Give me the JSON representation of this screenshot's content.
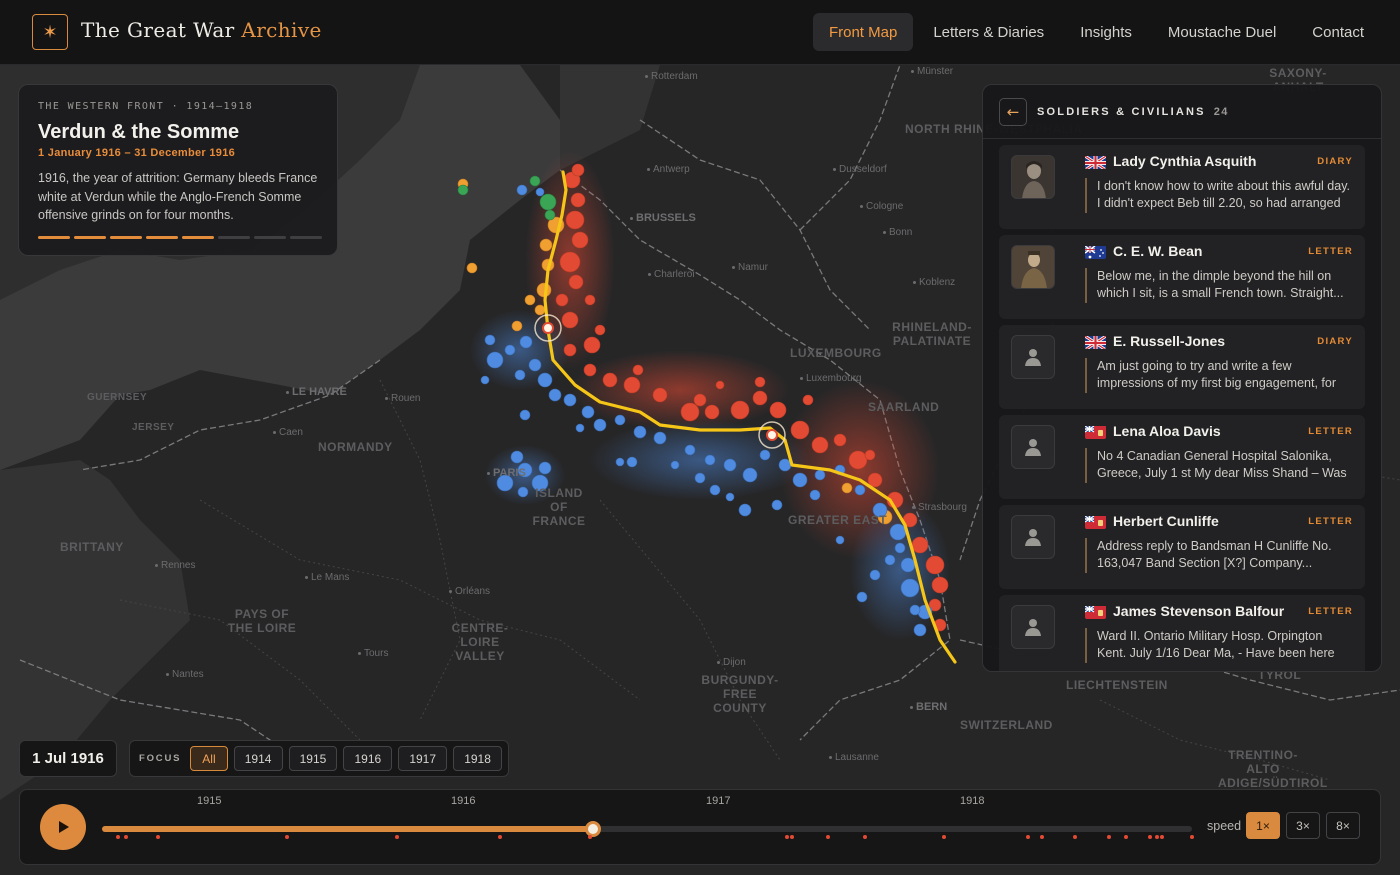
{
  "header": {
    "brand_main": "The Great War ",
    "brand_accent": "Archive",
    "nav": [
      "Front Map",
      "Letters & Diaries",
      "Insights",
      "Moustache Duel",
      "Contact"
    ],
    "active_nav": "Front Map"
  },
  "map": {
    "regions": [
      "NORTH RHINE-WESTPHALIA",
      "RHINELAND-PALATINATE",
      "LUXEMBOURG",
      "SAARLAND",
      "NORMANDY",
      "BRITTANY",
      "PAYS OF THE LOIRE",
      "CENTRE-LOIRE VALLEY",
      "BURGUNDY-FREE COUNTY",
      "ISLAND OF FRANCE",
      "GREATER EAST",
      "SWITZERLAND",
      "GUERNSEY",
      "JERSEY",
      "LIECHTENSTEIN",
      "TRENTINO-ALTO ADIGE/SÜDTIROL",
      "TYROL",
      "SAXONY-ANHALT"
    ],
    "cities": [
      "Rotterdam",
      "Münster",
      "Antwerp",
      "Dusseldorf",
      "BRUSSELS",
      "Cologne",
      "Bonn",
      "Charleroi",
      "Namur",
      "Koblenz",
      "Luxembourg",
      "Rouen",
      "LE HAVRE",
      "Caen",
      "PARIS",
      "Rennes",
      "Le Mans",
      "Orléans",
      "Tours",
      "Nantes",
      "Dijon",
      "Strasbourg",
      "BERN",
      "Lausanne"
    ]
  },
  "info": {
    "eyebrow": "THE WESTERN FRONT · 1914–1918",
    "title": "Verdun & the Somme",
    "dates": "1 January 1916 – 31 December 1916",
    "description": "1916, the year of attrition: Germany bleeds France white at Verdun while the Anglo-French Somme offensive grinds on for four months.",
    "progress_segments_total": 8,
    "progress_segments_done": 5
  },
  "panel": {
    "title": "SOLDIERS & CIVILIANS",
    "count": "24",
    "entries": [
      {
        "name": "Lady Cynthia Asquith",
        "type": "DIARY",
        "flag": "uk",
        "avatar": "photo",
        "excerpt": "I don't know how to write about this awful day. I didn't expect Beb till 2.20, so had arranged to..."
      },
      {
        "name": "C. E. W. Bean",
        "type": "LETTER",
        "flag": "australia",
        "avatar": "photo",
        "excerpt": "Below me, in the dimple beyond the hill on which I sit, is a small French town. Straight..."
      },
      {
        "name": "E. Russell-Jones",
        "type": "DIARY",
        "flag": "uk",
        "avatar": "placeholder",
        "excerpt": "Am just going to try and write a few impressions of my first big engagement, for we're within a..."
      },
      {
        "name": "Lena Aloa Davis",
        "type": "LETTER",
        "flag": "canada",
        "avatar": "placeholder",
        "excerpt": "No 4 Canadian General Hospital Salonika, Greece, July 1 st My dear Miss Shand – Was s..."
      },
      {
        "name": "Herbert Cunliffe",
        "type": "LETTER",
        "flag": "canada",
        "avatar": "placeholder",
        "excerpt": "Address reply to Bandsman H Cunliffe No. 163,047 Band Section [X?] Company..."
      },
      {
        "name": "James Stevenson Balfour",
        "type": "LETTER",
        "flag": "canada",
        "avatar": "placeholder",
        "excerpt": "Ward II. Ontario Military Hosp. Orpington Kent. July 1/16 Dear Ma, - Have been here more tha..."
      }
    ]
  },
  "controls": {
    "current_date": "1 Jul 1916",
    "focus_label": "FOCUS",
    "focus_options": [
      "All",
      "1914",
      "1915",
      "1916",
      "1917",
      "1918"
    ],
    "focus_active": "All",
    "year_ticks": [
      "1915",
      "1916",
      "1917",
      "1918"
    ],
    "progress": 0.45,
    "speed_label": "speed",
    "speeds": [
      "1×",
      "3×",
      "8×"
    ],
    "speed_active": "1×"
  },
  "colors": {
    "accent": "#e38d3c",
    "front_line": "#f5c518",
    "allied": "#4f8be0",
    "central": "#e34a33",
    "british_early": "#f0a030",
    "belgian": "#3aa655"
  }
}
